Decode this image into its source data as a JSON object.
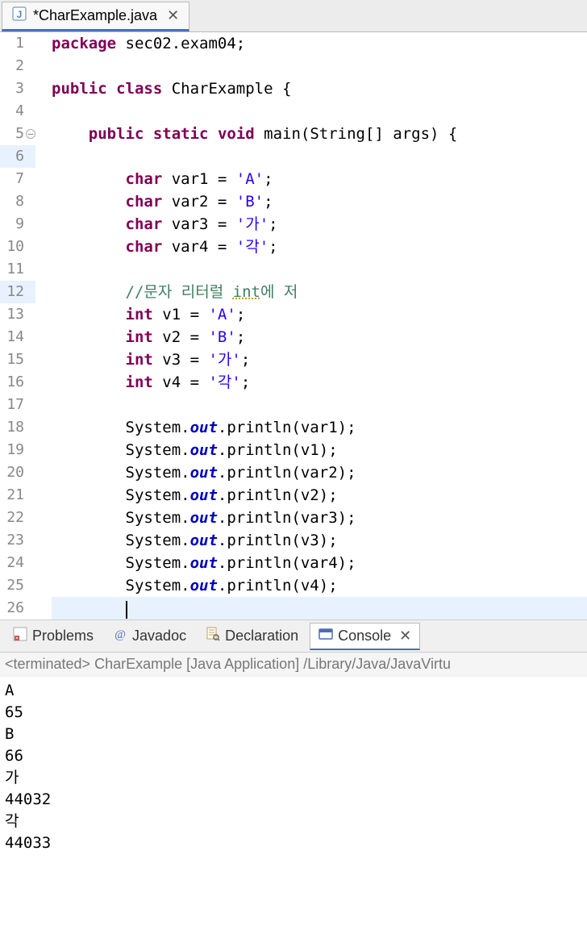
{
  "editor": {
    "tab_title": "*CharExample.java",
    "lines": [
      {
        "n": 1,
        "stripe": false,
        "marker": "",
        "html": "<span class='kw'>package</span> sec02.exam04;"
      },
      {
        "n": 2,
        "stripe": false,
        "marker": "",
        "html": ""
      },
      {
        "n": 3,
        "stripe": false,
        "marker": "",
        "html": "<span class='kw'>public</span> <span class='kw'>class</span> CharExample {"
      },
      {
        "n": 4,
        "stripe": false,
        "marker": "",
        "html": ""
      },
      {
        "n": 5,
        "stripe": true,
        "marker": "fold",
        "html": "    <span class='kw'>public</span> <span class='kw'>static</span> <span class='kw'>void</span> main(String[] args) {"
      },
      {
        "n": 6,
        "stripe": true,
        "marker": "",
        "hl": true,
        "html": ""
      },
      {
        "n": 7,
        "stripe": true,
        "marker": "",
        "html": "        <span class='kw'>char</span> var1 = <span class='str'>'A'</span>;"
      },
      {
        "n": 8,
        "stripe": true,
        "marker": "",
        "html": "        <span class='kw'>char</span> var2 = <span class='str'>'B'</span>;"
      },
      {
        "n": 9,
        "stripe": true,
        "marker": "",
        "html": "        <span class='kw'>char</span> var3 = <span class='str'>'가'</span>;"
      },
      {
        "n": 10,
        "stripe": true,
        "marker": "",
        "html": "        <span class='kw'>char</span> var4 = <span class='str'>'각'</span>;"
      },
      {
        "n": 11,
        "stripe": true,
        "marker": "",
        "html": ""
      },
      {
        "n": 12,
        "stripe": true,
        "marker": "",
        "hl": true,
        "html": "        <span class='cmt'>//문자 리터럴 <span class='underline-warn'>int</span>에 저</span>"
      },
      {
        "n": 13,
        "stripe": true,
        "marker": "",
        "html": "        <span class='kw'>int</span> v1 = <span class='str'>'A'</span>;"
      },
      {
        "n": 14,
        "stripe": true,
        "marker": "",
        "html": "        <span class='kw'>int</span> v2 = <span class='str'>'B'</span>;"
      },
      {
        "n": 15,
        "stripe": true,
        "marker": "",
        "html": "        <span class='kw'>int</span> v3 = <span class='str'>'가'</span>;"
      },
      {
        "n": 16,
        "stripe": true,
        "marker": "",
        "html": "        <span class='kw'>int</span> v4 = <span class='str'>'각'</span>;"
      },
      {
        "n": 17,
        "stripe": true,
        "marker": "",
        "html": ""
      },
      {
        "n": 18,
        "stripe": true,
        "marker": "",
        "html": "        System.<span class='field'>out</span>.println(var1);"
      },
      {
        "n": 19,
        "stripe": true,
        "marker": "",
        "html": "        System.<span class='field'>out</span>.println(v1);"
      },
      {
        "n": 20,
        "stripe": true,
        "marker": "",
        "html": "        System.<span class='field'>out</span>.println(var2);"
      },
      {
        "n": 21,
        "stripe": true,
        "marker": "",
        "html": "        System.<span class='field'>out</span>.println(v2);"
      },
      {
        "n": 22,
        "stripe": true,
        "marker": "",
        "html": "        System.<span class='field'>out</span>.println(var3);"
      },
      {
        "n": 23,
        "stripe": true,
        "marker": "",
        "html": "        System.<span class='field'>out</span>.println(v3);"
      },
      {
        "n": 24,
        "stripe": true,
        "marker": "",
        "html": "        System.<span class='field'>out</span>.println(var4);"
      },
      {
        "n": 25,
        "stripe": true,
        "marker": "",
        "html": "        System.<span class='field'>out</span>.println(v4);"
      },
      {
        "n": 26,
        "stripe": true,
        "marker": "",
        "current": true,
        "html": "        <span class='caret'></span>"
      }
    ]
  },
  "bottom_tabs": {
    "problems": "Problems",
    "javadoc": "Javadoc",
    "declaration": "Declaration",
    "console": "Console"
  },
  "console": {
    "status": "<terminated> CharExample [Java Application] /Library/Java/JavaVirtu",
    "output": [
      "A",
      "65",
      "B",
      "66",
      "가",
      "44032",
      "각",
      "44033"
    ]
  }
}
